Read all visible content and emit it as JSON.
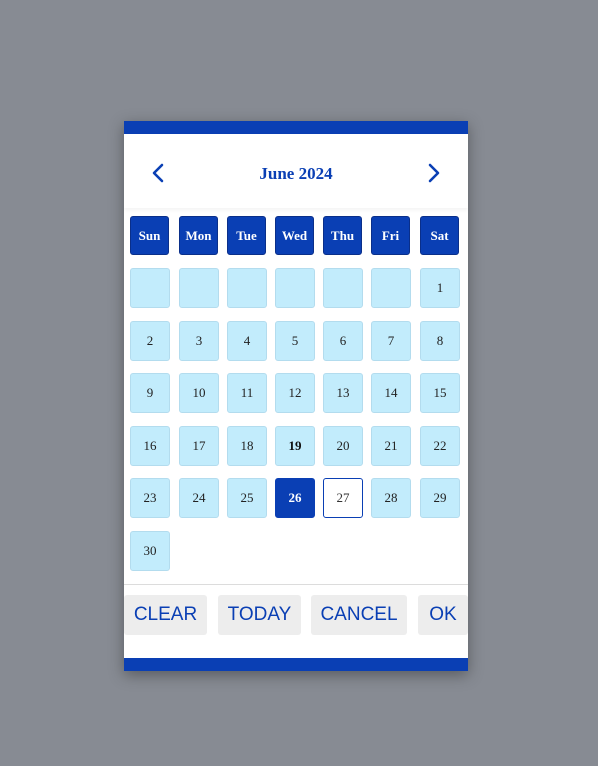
{
  "header": {
    "month_title": "June 2024"
  },
  "weekdays": [
    "Sun",
    "Mon",
    "Tue",
    "Wed",
    "Thu",
    "Fri",
    "Sat"
  ],
  "weeks": [
    [
      "",
      "",
      "",
      "",
      "",
      "",
      "1"
    ],
    [
      "2",
      "3",
      "4",
      "5",
      "6",
      "7",
      "8"
    ],
    [
      "9",
      "10",
      "11",
      "12",
      "13",
      "14",
      "15"
    ],
    [
      "16",
      "17",
      "18",
      "19",
      "20",
      "21",
      "22"
    ],
    [
      "23",
      "24",
      "25",
      "26",
      "27",
      "28",
      "29"
    ],
    [
      "30"
    ]
  ],
  "highlight": {
    "selected_day": "26",
    "outlined_day": "27",
    "bold_day": "19"
  },
  "actions": {
    "clear_label": "CLEAR",
    "today_label": "TODAY",
    "cancel_label": "CANCEL",
    "ok_label": "OK"
  },
  "colors": {
    "accent": "#0a3fb4",
    "day_bg": "#c2ecfc",
    "backdrop": "#878b93"
  },
  "icons": {
    "prev": "chevron-left-icon",
    "next": "chevron-right-icon"
  }
}
